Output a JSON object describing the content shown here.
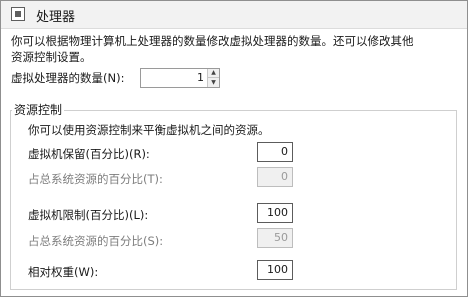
{
  "header": {
    "title": "处理器",
    "icon": "processor-icon"
  },
  "description": {
    "line1": "你可以根据物理计算机上处理器的数量修改虚拟处理器的数量。还可以修改其他",
    "line2": "资源控制设置。"
  },
  "processors": {
    "label": "虚拟处理器的数量(N):",
    "value": "1"
  },
  "resource_control": {
    "title": "资源控制",
    "description": "你可以使用资源控制来平衡虚拟机之间的资源。",
    "reserve": {
      "label": "虚拟机保留(百分比)(R):",
      "value": "0"
    },
    "reserve_total": {
      "label": "占总系统资源的百分比(T):",
      "value": "0"
    },
    "limit": {
      "label": "虚拟机限制(百分比)(L):",
      "value": "100"
    },
    "limit_total": {
      "label": "占总系统资源的百分比(S):",
      "value": "50"
    },
    "weight": {
      "label": "相对权重(W):",
      "value": "100"
    }
  }
}
